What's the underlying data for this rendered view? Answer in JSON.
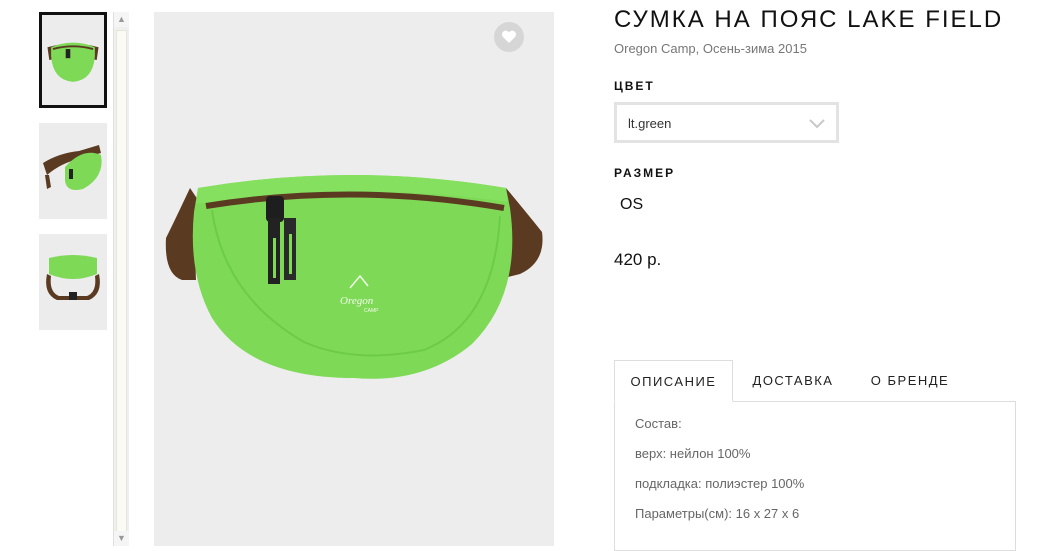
{
  "gallery": {
    "thumbnails": [
      {
        "alt": "front",
        "active": true
      },
      {
        "alt": "side",
        "active": false
      },
      {
        "alt": "back",
        "active": false
      }
    ],
    "scroll_up_icon": "arrow-up",
    "scroll_down_icon": "arrow-down"
  },
  "main_image": {
    "logo_text": "Oregon",
    "logo_subtext": "CAMP",
    "favorite_icon": "heart"
  },
  "product": {
    "title": "СУМКА НА ПОЯС LAKE FIELD",
    "subtitle": "Oregon Camp, Осень-зима 2015",
    "color_label": "ЦВЕТ",
    "color_value": "lt.green",
    "size_label": "РАЗМЕР",
    "size_value": "OS",
    "price": "420 р."
  },
  "tabs": {
    "items": [
      {
        "label": "ОПИСАНИЕ",
        "active": true
      },
      {
        "label": "ДОСТАВКА",
        "active": false
      },
      {
        "label": "О БРЕНДЕ",
        "active": false
      }
    ],
    "description": [
      "Состав:",
      "верх: нейлон 100%",
      "подкладка: полиэстер 100%",
      "Параметры(см): 16 х 27 х 6"
    ]
  },
  "colors": {
    "bag_green": "#7ed957",
    "strap_brown": "#5a3b22",
    "accent_black": "#111111"
  }
}
